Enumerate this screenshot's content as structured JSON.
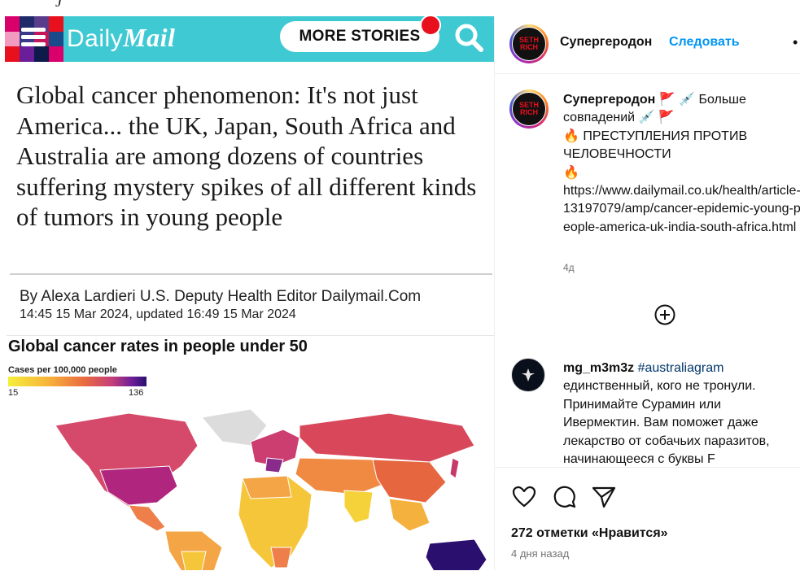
{
  "article": {
    "brand": {
      "prefix": "Daily",
      "suffix": "Mail"
    },
    "more_stories_label": "MORE STORIES",
    "headline": "Global cancer phenomenon: It's not just America... the UK, Japan, South Africa and Australia are among dozens of countries suffering mystery spikes of all different kinds of tumors in young people",
    "byline": "By Alexa Lardieri U.S. Deputy Health Editor Dailymail.Com",
    "dateline": "14:45 15 Mar 2024, updated 16:49 15 Mar 2024",
    "chart": {
      "title": "Global cancer rates in people under 50",
      "legend_label": "Cases per 100,000 people",
      "legend_min": "15",
      "legend_max": "136"
    }
  },
  "instagram": {
    "header_username": "Супергеродон",
    "follow_label": "Следовать",
    "caption": {
      "username": "Супергеродон",
      "line1_suffix": " 🚩 💉 Больше совпадений 💉 🚩",
      "line2": "🔥 ПРЕСТУПЛЕНИЯ ПРОТИВ ЧЕЛОВЕЧНОСТИ",
      "line3": "🔥",
      "url": "https://www.dailymail.co.uk/health/article-13197079/amp/cancer-epidemic-young-people-america-uk-india-south-africa.html",
      "time": "4д"
    },
    "comment": {
      "username": "mg_m3m3z",
      "hashtag": "#australiagram",
      "text": "единственный, кого не тронули. Принимайте Сурамин или Ивермектин. Вам поможет даже лекарство от собачьих паразитов, начинающееся с буквы F"
    },
    "likes": "272 отметки «Нравится»",
    "post_date": "4 дня назад"
  }
}
